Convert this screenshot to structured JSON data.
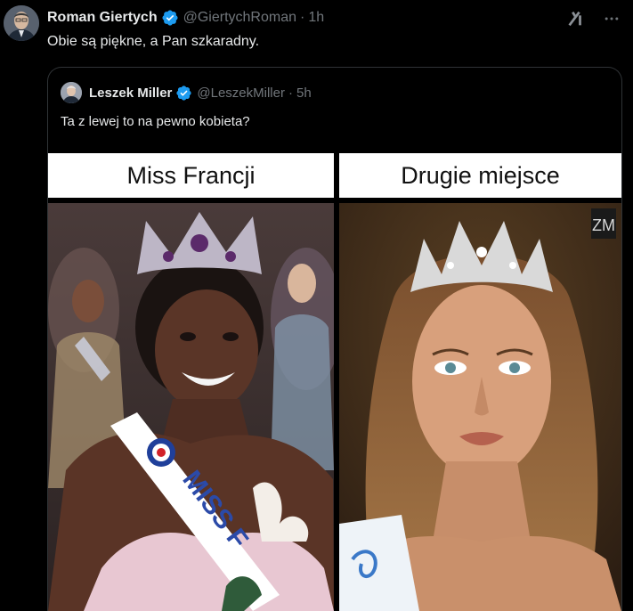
{
  "tweet": {
    "author_name": "Roman Giertych",
    "author_handle": "@GiertychRoman",
    "separator": "·",
    "time": "1h",
    "text": "Obie są piękne, a Pan szkaradny."
  },
  "top_icons": [
    "grok-icon",
    "more-icon"
  ],
  "quoted_tweet": {
    "author_name": "Leszek Miller",
    "author_handle": "@LeszekMiller",
    "separator": "·",
    "time": "5h",
    "text": "Ta z lewej to na pewno kobieta?"
  },
  "media": {
    "left_label": "Miss Francji",
    "right_label": "Drugie miejsce",
    "sash_text": "MISS F",
    "watermark": "ZM"
  },
  "colors": {
    "background": "#000000",
    "text": "#e7e9ea",
    "muted": "#71767b",
    "verified": "#1d9bf0",
    "border": "#2f3336"
  }
}
